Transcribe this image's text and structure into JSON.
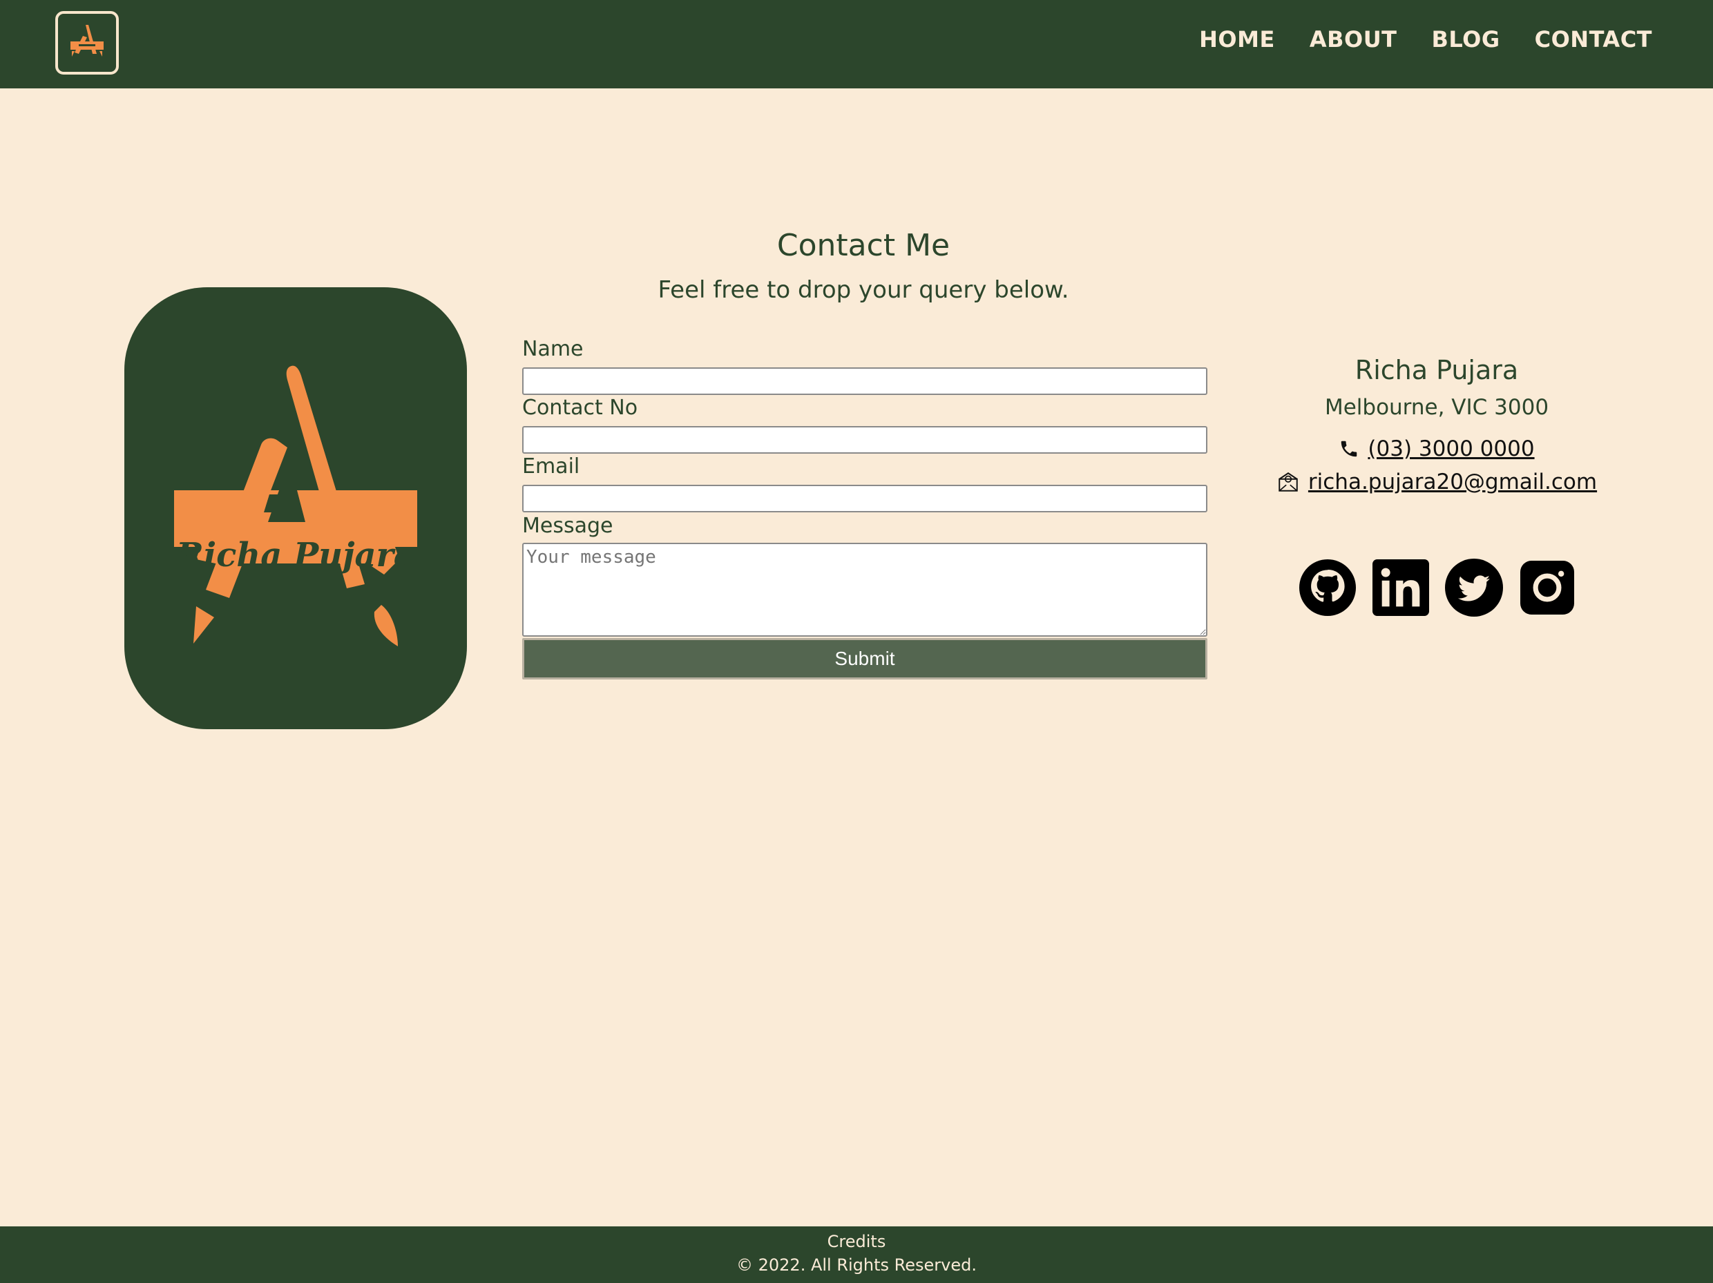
{
  "header": {
    "logo_icon": "richa-pujara-logo-icon",
    "nav": [
      {
        "label": "HOME"
      },
      {
        "label": "ABOUT"
      },
      {
        "label": "BLOG"
      },
      {
        "label": "CONTACT"
      }
    ]
  },
  "logo_card": {
    "brand_text": "Richa Pujara",
    "bg_color": "#2c462c",
    "accent_color": "#f28e47"
  },
  "contact_form": {
    "title": "Contact Me",
    "subtitle": "Feel free to drop your query below.",
    "fields": {
      "name": {
        "label": "Name",
        "value": ""
      },
      "contact_no": {
        "label": "Contact No",
        "value": ""
      },
      "email": {
        "label": "Email",
        "value": ""
      },
      "message": {
        "label": "Message",
        "placeholder": "Your message"
      }
    },
    "submit_label": "Submit"
  },
  "contact_info": {
    "name": "Richa Pujara",
    "address": "Melbourne, VIC 3000",
    "phone": "(03) 3000 0000",
    "email": "richa.pujara20@gmail.com",
    "socials": [
      {
        "icon": "github-icon"
      },
      {
        "icon": "linkedin-icon"
      },
      {
        "icon": "twitter-icon"
      },
      {
        "icon": "instagram-icon"
      }
    ]
  },
  "footer": {
    "credits": "Credits",
    "copyright": "© 2022. All Rights Reserved."
  },
  "colors": {
    "primary": "#2c462c",
    "background": "#faebd7",
    "accent": "#f28e47",
    "button": "#546650"
  }
}
